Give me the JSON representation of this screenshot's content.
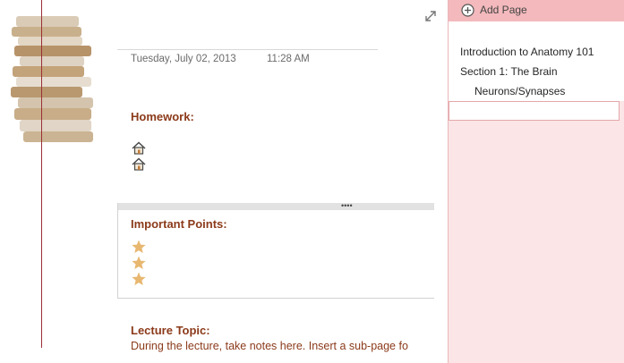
{
  "note": {
    "date": "Tuesday, July 02, 2013",
    "time": "11:28 AM",
    "homework_heading": "Homework:",
    "important_heading": "Important Points:",
    "important_dots": "••••",
    "lecture_heading": "Lecture Topic:",
    "lecture_body": "During the lecture, take notes here.  Insert a sub-page fo"
  },
  "icons": {
    "expand": "expand-arrows-icon",
    "homework_items": [
      "house-icon",
      "house-icon"
    ],
    "important_items": [
      "star-icon",
      "star-icon",
      "star-icon"
    ],
    "add_page": "plus-circle-icon"
  },
  "pages_pane": {
    "add_label": "Add Page",
    "pages": [
      {
        "label": "Introduction to Anatomy 101",
        "level": 1
      },
      {
        "label": "Section 1: The Brain",
        "level": 1
      },
      {
        "label": "Neurons/Synapses",
        "level": 2
      }
    ]
  },
  "colors": {
    "heading": "#8b3a1a",
    "margin_line": "#9b2f36",
    "pane_background": "#fbe5e6",
    "add_row": "#f3b9bc",
    "star": "#e8b770"
  }
}
